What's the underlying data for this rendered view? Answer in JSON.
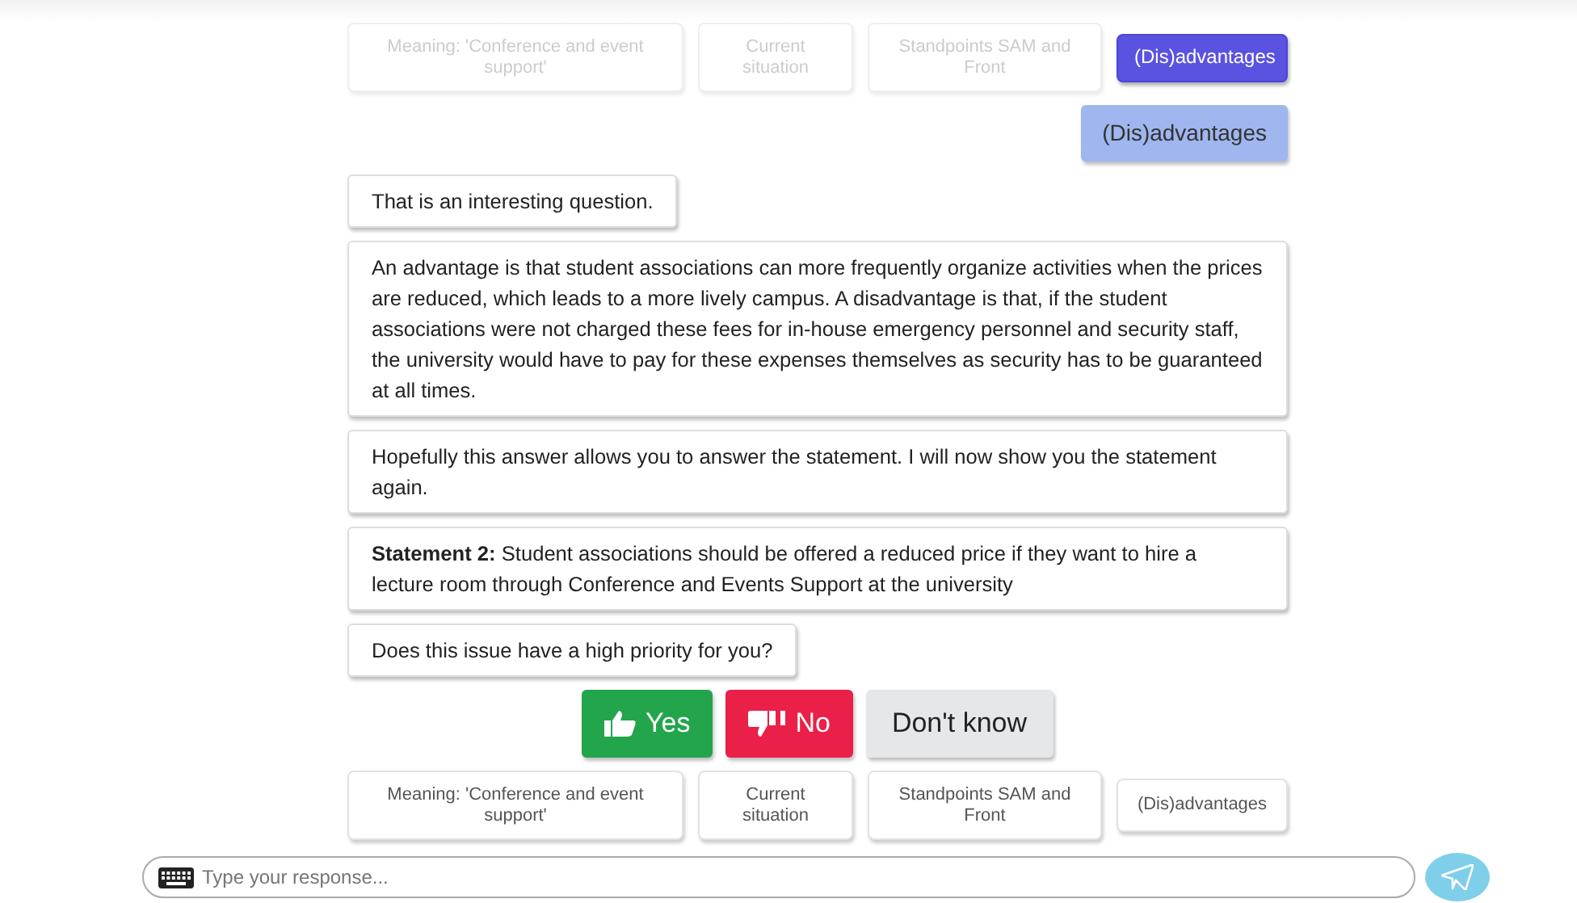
{
  "previous_options": [
    {
      "label": "Meaning: 'Conference and event support'",
      "selected": false,
      "disabled": true
    },
    {
      "label": "Current situation",
      "selected": false,
      "disabled": true
    },
    {
      "label": "Standpoints SAM and Front",
      "selected": false,
      "disabled": true
    },
    {
      "label": "(Dis)advantages",
      "selected": true,
      "disabled": true
    }
  ],
  "messages": [
    {
      "kind": "user",
      "text": "(Dis)advantages"
    },
    {
      "kind": "bot",
      "text": "That is an interesting question."
    },
    {
      "kind": "bot",
      "text": "An advantage is that student associations can more frequently organize activities when the prices are reduced, which leads to a more lively campus. A disadvantage is that, if the student associations were not charged these fees for in-house emergency personnel and security staff, the university would have to pay for these expenses themselves as security has to be guaranteed at all times."
    },
    {
      "kind": "bot",
      "text": "Hopefully this answer allows you to answer the statement. I will now show you the statement again."
    },
    {
      "kind": "bot",
      "text": "**Statement 2:** Student associations should be offered a reduced price if they want to hire a lecture room through Conference and Events Support at the university"
    },
    {
      "kind": "bot",
      "text": "Does this issue have a high priority for you?"
    }
  ],
  "answers": [
    {
      "kind": "yes",
      "label": "Yes"
    },
    {
      "kind": "no",
      "label": "No"
    },
    {
      "kind": "neutral",
      "label": "Don't know"
    }
  ],
  "options": [
    {
      "label": "Meaning: 'Conference and event support'",
      "selected": false,
      "disabled": false
    },
    {
      "label": "Current situation",
      "selected": false,
      "disabled": false
    },
    {
      "label": "Standpoints SAM and Front",
      "selected": false,
      "disabled": false
    },
    {
      "label": "(Dis)advantages",
      "selected": false,
      "disabled": false
    }
  ],
  "input": {
    "placeholder": "Type your response..."
  }
}
